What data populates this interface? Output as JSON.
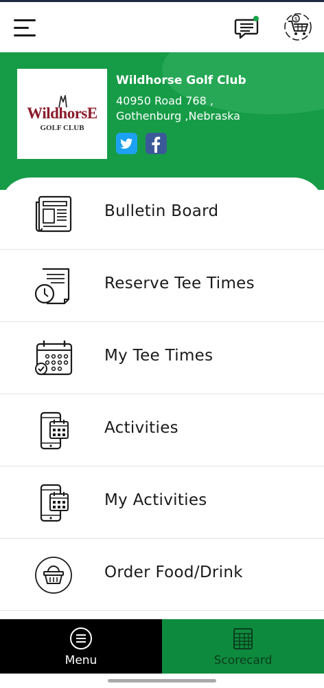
{
  "header": {
    "menu_icon": "hamburger-icon",
    "messages_icon": "chat-bubble-icon",
    "messages_badge_color": "#16a34a",
    "cart_icon": "cart-dollar-icon"
  },
  "club": {
    "name": "Wildhorse Golf Club",
    "address_line1": "40950 Road 768 ,",
    "address_line2": "Gothenburg ,Nebraska",
    "logo_text_main": "WildhorsE",
    "logo_text_sub": "GOLF CLUB",
    "social": [
      "twitter",
      "facebook"
    ],
    "brand_color": "#169c47"
  },
  "menu": {
    "items": [
      {
        "label": "Bulletin Board",
        "icon": "newspaper-icon"
      },
      {
        "label": "Reserve Tee Times",
        "icon": "clock-document-icon"
      },
      {
        "label": "My Tee Times",
        "icon": "calendar-check-icon"
      },
      {
        "label": "Activities",
        "icon": "phone-calendar-icon"
      },
      {
        "label": "My Activities",
        "icon": "phone-calendar-icon"
      },
      {
        "label": "Order Food/Drink",
        "icon": "basket-icon"
      }
    ]
  },
  "bottom_nav": {
    "menu_label": "Menu",
    "scorecard_label": "Scorecard",
    "active": "Menu"
  }
}
